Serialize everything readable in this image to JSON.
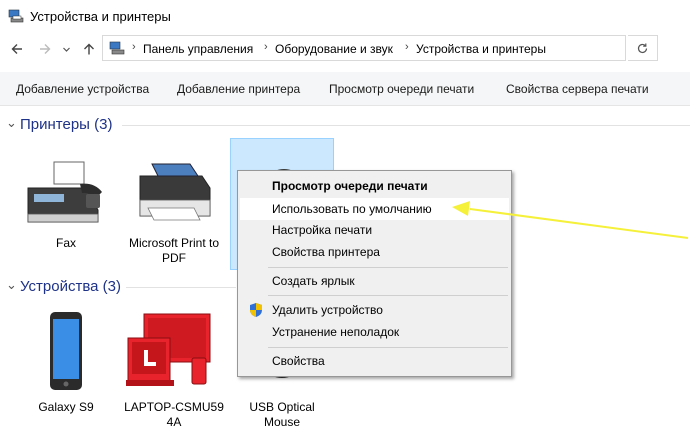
{
  "window": {
    "title": "Устройства и принтеры"
  },
  "breadcrumb": [
    "Панель управления",
    "Оборудование и звук",
    "Устройства и принтеры"
  ],
  "icons": {
    "back": "arrow-left-icon",
    "forward": "arrow-right-icon",
    "recent": "chevron-down-icon",
    "up": "arrow-up-icon",
    "refresh": "refresh-icon"
  },
  "toolbar": {
    "add_device": "Добавление устройства",
    "add_printer": "Добавление принтера",
    "view_queue": "Просмотр очереди печати",
    "server_props": "Свойства сервера печати"
  },
  "printers_group": {
    "title": "Принтеры (3)",
    "items": [
      {
        "label": "Fax",
        "icon": "fax-icon"
      },
      {
        "label": "Microsoft Print to PDF",
        "icon": "printer-icon"
      },
      {
        "label": "",
        "icon": "printer-icon",
        "selected": true
      }
    ]
  },
  "devices_group": {
    "title": "Устройства (3)",
    "items": [
      {
        "label": "Galaxy S9",
        "icon": "phone-icon"
      },
      {
        "label": "LAPTOP-CSMU59 4A",
        "icon": "laptop-icon"
      },
      {
        "label": "USB Optical Mouse",
        "icon": "mouse-icon"
      }
    ]
  },
  "context_menu": {
    "view_queue": "Просмотр очереди печати",
    "set_default": "Использовать по умолчанию",
    "print_settings": "Настройка печати",
    "printer_props": "Свойства принтера",
    "create_shortcut": "Создать ярлык",
    "remove_device": "Удалить устройство",
    "troubleshoot": "Устранение неполадок",
    "properties": "Свойства"
  },
  "colors": {
    "group_title": "#1e3287",
    "selection": "#cce8ff",
    "menu_bg": "#f0f0f0",
    "arrow": "#f5f03a",
    "device_red": "#e8232b"
  }
}
